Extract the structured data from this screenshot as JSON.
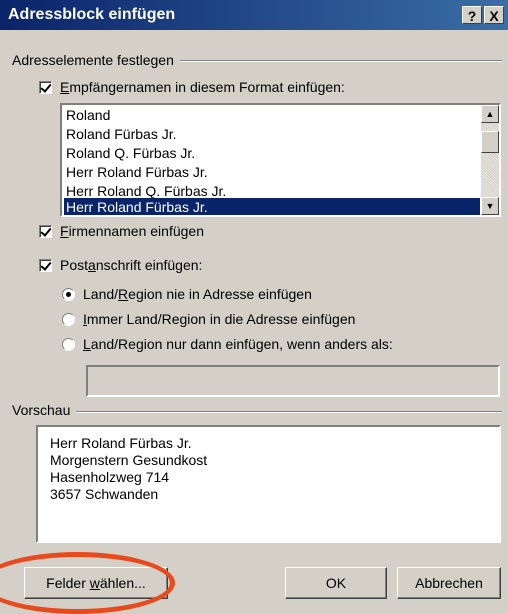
{
  "window": {
    "title": "Adressblock einfügen",
    "help_label": "?",
    "close_label": "X"
  },
  "address_elements": {
    "group_label": "Adresselemente festlegen",
    "recipient_checkbox": {
      "label_prefix": "",
      "mnemonic": "E",
      "label_rest": "mpfängernamen in diesem Format einfügen:",
      "checked": true
    },
    "name_formats": [
      "Roland",
      "Roland Fürbas Jr.",
      "Roland Q. Fürbas Jr.",
      "Herr Roland Fürbas Jr.",
      "Herr Roland Q. Fürbas Jr.",
      "Herr Roland Fürbas Jr."
    ],
    "selected_index": 5,
    "company_checkbox": {
      "mnemonic": "F",
      "label_rest": "irmennamen einfügen",
      "checked": true
    },
    "postal_checkbox": {
      "label_prefix": "Post",
      "mnemonic": "a",
      "label_rest": "nschrift einfügen:",
      "checked": true
    },
    "country_options": [
      {
        "label_prefix": "Land/",
        "mnemonic": "R",
        "label_rest": "egion nie in Adresse einfügen",
        "selected": true
      },
      {
        "label_prefix": "",
        "mnemonic": "I",
        "label_rest": "mmer Land/Region in die Adresse einfügen",
        "selected": false
      },
      {
        "label_prefix": "",
        "mnemonic": "L",
        "label_rest": "and/Region nur dann einfügen, wenn anders als:",
        "selected": false
      }
    ],
    "country_field_value": ""
  },
  "preview": {
    "group_label": "Vorschau",
    "lines": [
      "Herr Roland Fürbas Jr.",
      "Morgenstern Gesundkost",
      "Hasenholzweg 714",
      "3657 Schwanden"
    ]
  },
  "buttons": {
    "fields": {
      "label_prefix": "Felder ",
      "mnemonic": "w",
      "label_rest": "ählen..."
    },
    "ok": "OK",
    "cancel": "Abbrechen"
  },
  "colors": {
    "title_bar": "#0a246a",
    "selection": "#0a246a",
    "highlight_ring": "#e84a1c",
    "dialog_bg": "#d4d0c8"
  }
}
